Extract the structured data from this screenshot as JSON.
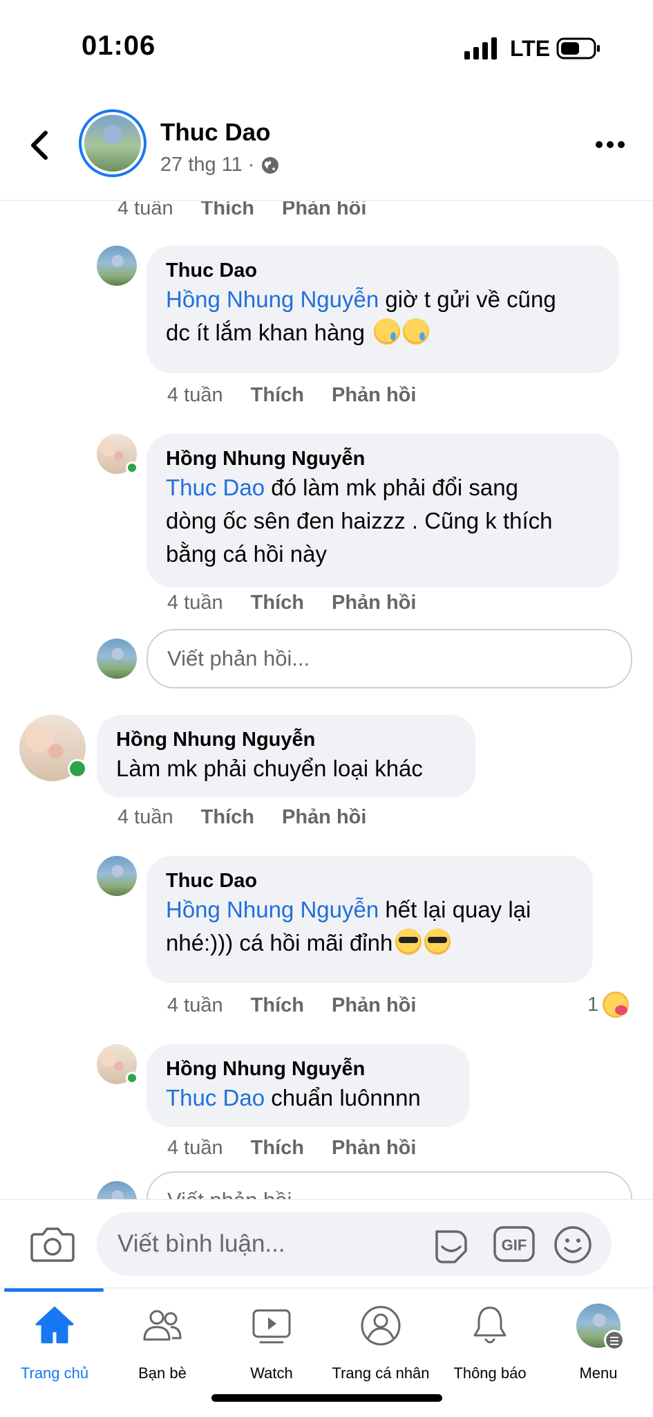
{
  "status_bar": {
    "time": "01:06",
    "network": "LTE"
  },
  "header": {
    "author": "Thuc Dao",
    "date": "27 thg 11",
    "separator": "·"
  },
  "comments": {
    "top_actions": {
      "time": "4 tuần",
      "like": "Thích",
      "reply": "Phản hồi"
    },
    "reply1": {
      "name": "Thuc Dao",
      "mention": "Hồng Nhung Nguyễn",
      "text_a": " giờ t gửi về cũng",
      "text_b": "dc ít lắm khan hàng",
      "time": "4 tuần",
      "like": "Thích",
      "reply": "Phản hồi"
    },
    "reply2": {
      "name": "Hồng Nhung Nguyễn",
      "mention": "Thuc Dao",
      "text_a": " đó làm mk phải đổi sang",
      "text_b": "dòng ốc sên đen haizzz . Cũng k thích",
      "text_c": "bằng cá hồi này",
      "time": "4 tuần",
      "like": "Thích",
      "reply": "Phản hồi"
    },
    "reply_input_placeholder": "Viết phản hồi...",
    "comment": {
      "name": "Hồng Nhung Nguyễn",
      "text": "Làm mk phải chuyển loại khác",
      "time": "4 tuần",
      "like": "Thích",
      "reply": "Phản hồi"
    },
    "reply3": {
      "name": "Thuc Dao",
      "mention": "Hồng Nhung Nguyễn",
      "text_a": " hết lại quay lại",
      "text_b": "nhé:))) cá hồi mãi đỉnh",
      "time": "4 tuần",
      "like": "Thích",
      "reply": "Phản hồi",
      "reaction_count": "1"
    },
    "reply4": {
      "name": "Hồng Nhung Nguyễn",
      "mention": "Thuc Dao",
      "text_a": " chuẩn luônnnn",
      "time": "4 tuần",
      "like": "Thích",
      "reply": "Phản hồi"
    },
    "reply_input2_placeholder": "Viết phản hồi..."
  },
  "composer": {
    "placeholder": "Viết bình luận...",
    "gif_label": "GIF"
  },
  "nav": {
    "home": "Trang chủ",
    "friends": "Bạn bè",
    "watch": "Watch",
    "profile": "Trang cá nhân",
    "notifications": "Thông báo",
    "menu": "Menu"
  },
  "colors": {
    "accent": "#1877f2",
    "mention": "#216fdb",
    "online": "#31a24c",
    "bubble": "#f0f2f5"
  }
}
